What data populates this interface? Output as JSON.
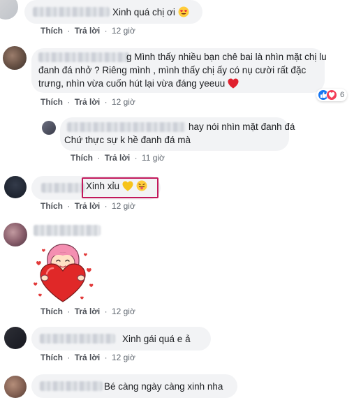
{
  "actions": {
    "like": "Thích",
    "reply": "Trả lời",
    "separator": "·"
  },
  "comments": [
    {
      "text": "Xinh quá chị ơi",
      "time": "12 giờ"
    },
    {
      "lines": [
        "g Mình thấy nhiều bạn chê bai là nhìn mặt chị lu",
        "đanh đá nhở ? Riêng mình , mình thấy chị ấy có nụ cười rất đặc",
        "trưng, nhìn vừa cuốn hút lại vừa đáng yeeuu"
      ],
      "time": "12 giờ",
      "reaction_count": "6"
    },
    {
      "lines": [
        "hay nói nhìn mặt đanh đá",
        "Chứ thực sự k hề đanh đá mà"
      ],
      "time": "11 giờ"
    },
    {
      "text": "Xinh xỉu",
      "time": "12 giờ"
    },
    {
      "sticker": "girl-holding-heart-sticker",
      "time": "12 giờ"
    },
    {
      "text": "Xinh gái quá e ả",
      "time": "12 giờ"
    },
    {
      "text": "Bé càng ngày càng xinh nha"
    }
  ],
  "colors": {
    "bubble": "#f2f3f5",
    "highlight": "#c2185b",
    "like_blue": "#1877f2",
    "love_red": "#f33e58"
  },
  "icons": [
    "heart-eyes-emoji",
    "red-heart-emoji",
    "yellow-heart-emoji",
    "tongue-out-emoji",
    "like-icon",
    "love-icon"
  ]
}
